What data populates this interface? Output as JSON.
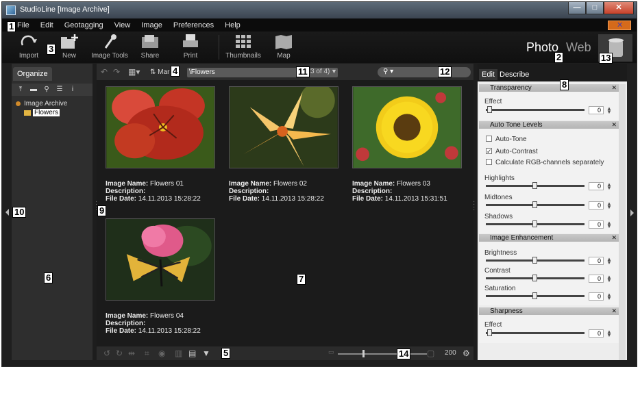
{
  "window": {
    "title": "StudioLine [Image Archive]",
    "min": "—",
    "max": "□",
    "close": "✕"
  },
  "menu": [
    "File",
    "Edit",
    "Geotagging",
    "View",
    "Image",
    "Preferences",
    "Help"
  ],
  "toolbar": {
    "tools": [
      {
        "label": "Import",
        "icon": "import-icon"
      },
      {
        "label": "New",
        "icon": "new-folder-icon"
      },
      {
        "label": "Image Tools",
        "icon": "image-tools-icon"
      },
      {
        "label": "Share",
        "icon": "share-icon"
      },
      {
        "label": "Print",
        "icon": "print-icon"
      },
      {
        "label": "Thumbnails",
        "icon": "thumbnails-icon"
      },
      {
        "label": "Map",
        "icon": "map-icon"
      }
    ],
    "mode_photo": "Photo",
    "mode_web": "Web"
  },
  "organize": {
    "tab": "Organize",
    "tree": {
      "root": "Image Archive",
      "child": "Flowers"
    }
  },
  "nav": {
    "sort_label": "Mar",
    "path": "\\Flowers",
    "page": "3 of 4)"
  },
  "thumbnails": [
    {
      "name": "Flowers 01",
      "description": "",
      "file_date": "14.11.2013 15:28:22",
      "image": "red-flower"
    },
    {
      "name": "Flowers 02",
      "description": "",
      "file_date": "14.11.2013 15:28:22",
      "image": "lily"
    },
    {
      "name": "Flowers 03",
      "description": "",
      "file_date": "14.11.2013 15:31:51",
      "image": "sunflower"
    },
    {
      "name": "Flowers 04",
      "description": "",
      "file_date": "14.11.2013 15:28:22",
      "image": "butterfly"
    }
  ],
  "meta_labels": {
    "name": "Image Name:",
    "description": "Description:",
    "file_date": "File Date:"
  },
  "status": {
    "zoom": "200"
  },
  "edit_panel": {
    "tabs": [
      "Edit",
      "Describe"
    ],
    "transparency": {
      "title": "Transparency",
      "effect_label": "Effect",
      "effect": "0"
    },
    "auto_tone": {
      "title": "Auto Tone Levels",
      "auto_tone": "Auto-Tone",
      "auto_contrast": "Auto-Contrast",
      "rgb": "Calculate RGB-channels separately",
      "highlights_label": "Highlights",
      "highlights": "0",
      "midtones_label": "Midtones",
      "midtones": "0",
      "shadows_label": "Shadows",
      "shadows": "0"
    },
    "enhancement": {
      "title": "Image Enhancement",
      "brightness_label": "Brightness",
      "brightness": "0",
      "contrast_label": "Contrast",
      "contrast": "0",
      "saturation_label": "Saturation",
      "saturation": "0"
    },
    "sharpness": {
      "title": "Sharpness",
      "effect_label": "Effect",
      "effect": "0"
    }
  },
  "callouts": [
    "1",
    "2",
    "3",
    "4",
    "5",
    "6",
    "7",
    "8",
    "9",
    "10",
    "11",
    "12",
    "13",
    "14"
  ]
}
